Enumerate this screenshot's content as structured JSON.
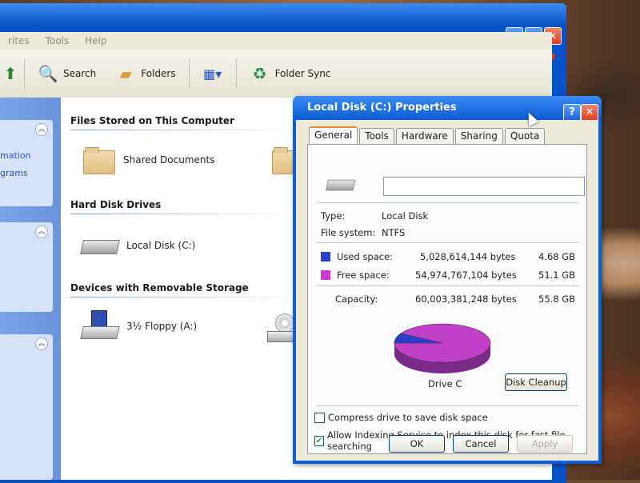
{
  "explorer": {
    "menu": [
      "rites",
      "Tools",
      "Help"
    ],
    "toolbar": {
      "search_label": "Search",
      "folders_label": "Folders",
      "foldersync_label": "Folder Sync"
    },
    "taskpane_links": [
      "mation",
      "grams"
    ],
    "groups": {
      "files_title": "Files Stored on This Computer",
      "hdd_title": "Hard Disk Drives",
      "removable_title": "Devices with Removable Storage"
    },
    "items": {
      "shared_docs": "Shared Documents",
      "local_disk": "Local Disk (C:)",
      "floppy": "3½ Floppy (A:)"
    }
  },
  "dialog": {
    "title": "Local Disk (C:) Properties",
    "help_glyph": "?",
    "close_glyph": "✕",
    "tabs": [
      "General",
      "Tools",
      "Hardware",
      "Sharing",
      "Quota"
    ],
    "active_tab": "General",
    "volume_name": "",
    "type_label": "Type:",
    "type_value": "Local Disk",
    "fs_label": "File system:",
    "fs_value": "NTFS",
    "used_label": "Used space:",
    "used_bytes": "5,028,614,144 bytes",
    "used_gb": "4.68 GB",
    "free_label": "Free space:",
    "free_bytes": "54,974,767,104 bytes",
    "free_gb": "51.1 GB",
    "capacity_label": "Capacity:",
    "capacity_bytes": "60,003,381,248 bytes",
    "capacity_gb": "55.8 GB",
    "drive_label": "Drive C",
    "disk_cleanup": "Disk Cleanup",
    "compress_label": "Compress drive to save disk space",
    "compress_checked": false,
    "index_label": "Allow Indexing Service to index this disk for fast file searching",
    "index_checked": true,
    "ok": "OK",
    "cancel": "Cancel",
    "apply": "Apply",
    "used_fraction": 0.0838,
    "colors": {
      "used": "#2b40c8",
      "free": "#c040c8"
    }
  }
}
